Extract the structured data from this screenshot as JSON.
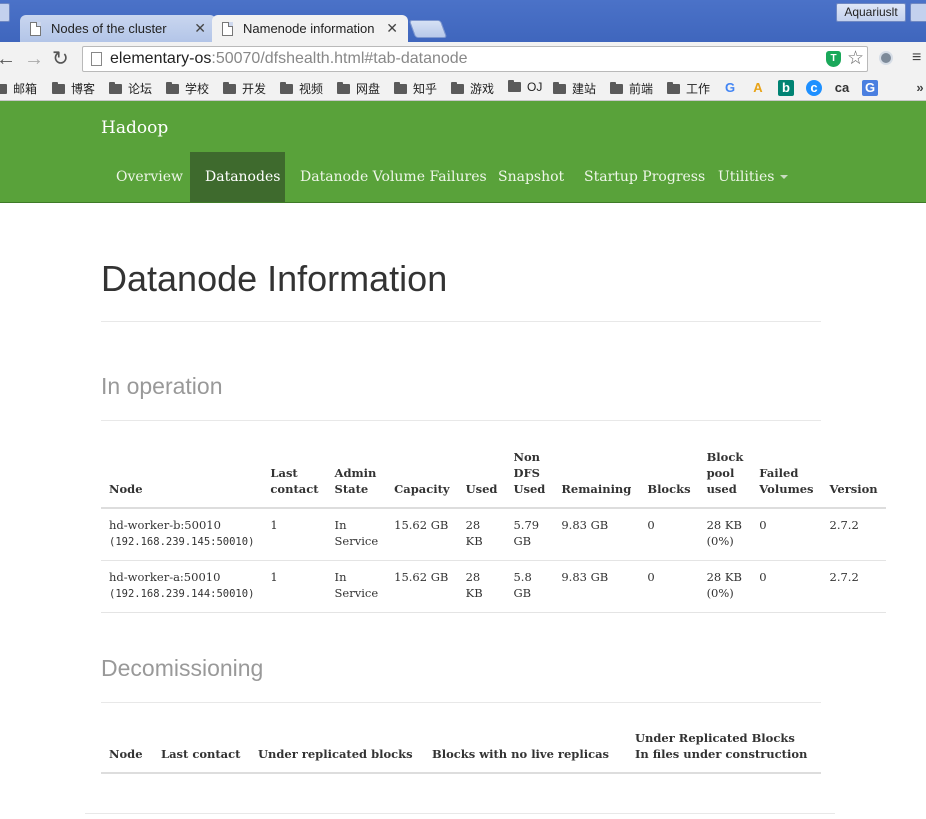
{
  "browser": {
    "tabs": [
      {
        "title": "Nodes of the cluster",
        "active": false
      },
      {
        "title": "Namenode information",
        "active": true
      }
    ],
    "user": "Aquariuslt",
    "url_host": "elementary-os",
    "url_rest": ":50070/dfshealth.html#tab-datanode",
    "bookmarks": [
      "邮箱",
      "博客",
      "论坛",
      "学校",
      "开发",
      "视频",
      "网盘",
      "知乎",
      "游戏",
      "OJ",
      "建站",
      "前端",
      "工作"
    ],
    "more": "»"
  },
  "navbar": {
    "brand": "Hadoop",
    "items": [
      "Overview",
      "Datanodes",
      "Datanode Volume Failures",
      "Snapshot",
      "Startup Progress",
      "Utilities"
    ],
    "active_index": 1
  },
  "page": {
    "title": "Datanode Information",
    "in_operation": {
      "heading": "In operation",
      "headers": [
        "Node",
        "Last contact",
        "Admin State",
        "Capacity",
        "Used",
        "Non DFS Used",
        "Remaining",
        "Blocks",
        "Block pool used",
        "Failed Volumes",
        "Version"
      ],
      "rows": [
        {
          "node": "hd-worker-b:50010",
          "addr": "(192.168.239.145:50010)",
          "last_contact": "1",
          "admin_state": "In Service",
          "capacity": "15.62 GB",
          "used": "28 KB",
          "non_dfs": "5.79 GB",
          "remaining": "9.83 GB",
          "blocks": "0",
          "pool_used": "28 KB (0%)",
          "failed": "0",
          "version": "2.7.2"
        },
        {
          "node": "hd-worker-a:50010",
          "addr": "(192.168.239.144:50010)",
          "last_contact": "1",
          "admin_state": "In Service",
          "capacity": "15.62 GB",
          "used": "28 KB",
          "non_dfs": "5.8 GB",
          "remaining": "9.83 GB",
          "blocks": "0",
          "pool_used": "28 KB (0%)",
          "failed": "0",
          "version": "2.7.2"
        }
      ]
    },
    "decommissioning": {
      "heading": "Decomissioning",
      "headers": [
        "Node",
        "Last contact",
        "Under replicated blocks",
        "Blocks with no live replicas",
        "Under Replicated Blocks",
        "In files under construction"
      ]
    }
  }
}
